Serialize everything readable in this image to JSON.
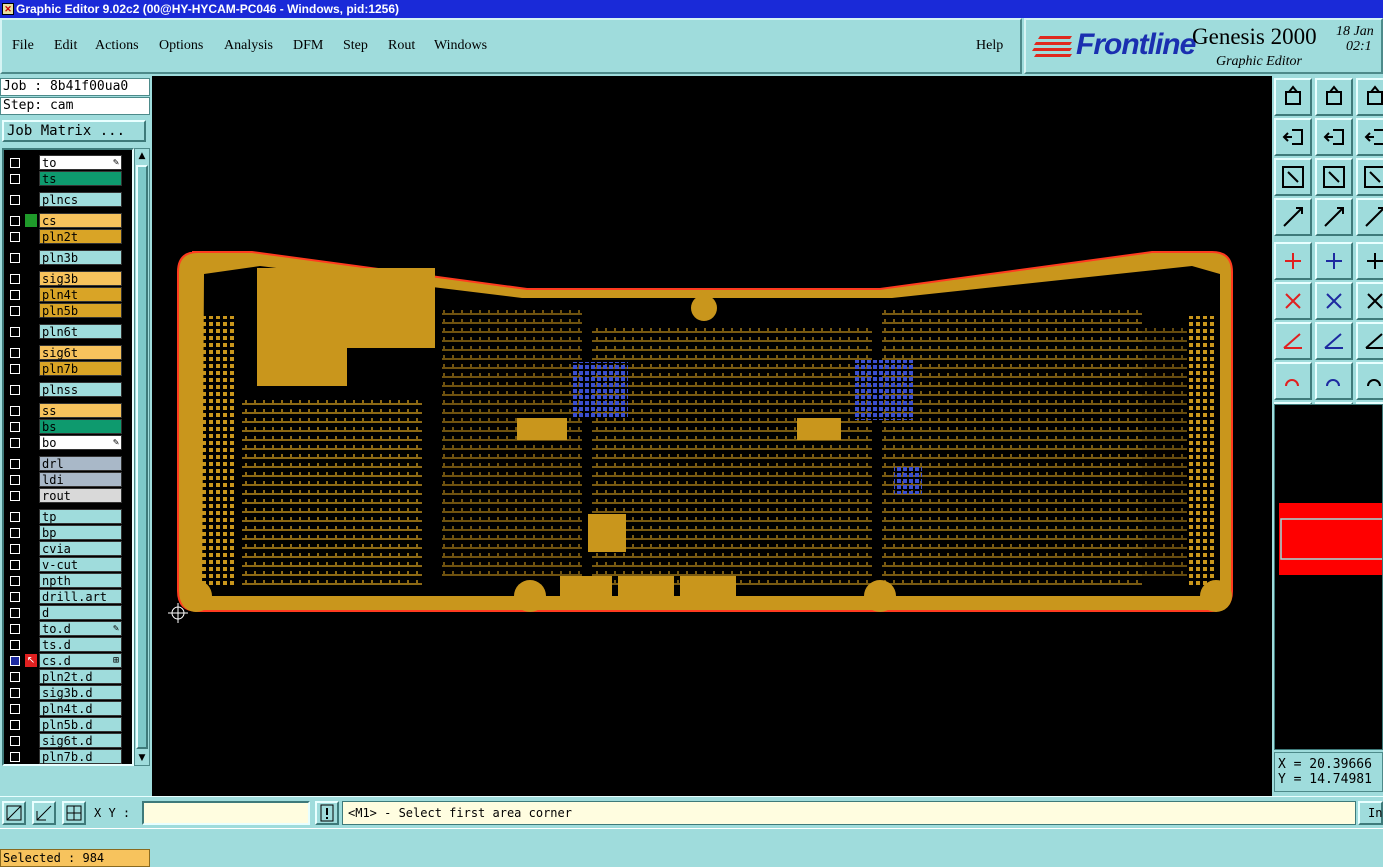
{
  "window": {
    "title": "Graphic Editor 9.02c2 (00@HY-HYCAM-PC046 - Windows, pid:1256)"
  },
  "menu": {
    "items": [
      {
        "label": "File"
      },
      {
        "label": "Edit"
      },
      {
        "label": "Actions"
      },
      {
        "label": "Options"
      },
      {
        "label": "Analysis"
      },
      {
        "label": "DFM"
      },
      {
        "label": "Step"
      },
      {
        "label": "Rout"
      },
      {
        "label": "Windows"
      },
      {
        "label": "Help"
      }
    ]
  },
  "brand": {
    "logo": "Frontline",
    "product": "Genesis 2000",
    "subtitle": "Graphic Editor",
    "date_line1": "18 Jan",
    "date_line2": "02:1"
  },
  "job": {
    "job_label": "Job : 8b41f00ua0",
    "step_label": "Step: cam",
    "matrix_button": "Job Matrix ..."
  },
  "layers": [
    {
      "name": "to",
      "color": "#ffffff",
      "tick": true
    },
    {
      "name": "ts",
      "color": "#0e9a6e"
    },
    {
      "name": "plncs",
      "color": "#9fdcdc"
    },
    {
      "name": "cs",
      "color": "#f7c35d",
      "mark": "#1f9a2a"
    },
    {
      "name": "pln2t",
      "color": "#d9a426"
    },
    {
      "name": "pln3b",
      "color": "#9fdcdc"
    },
    {
      "name": "sig3b",
      "color": "#f7c35d"
    },
    {
      "name": "pln4t",
      "color": "#d9a426"
    },
    {
      "name": "pln5b",
      "color": "#d9a426"
    },
    {
      "name": "pln6t",
      "color": "#9fdcdc"
    },
    {
      "name": "sig6t",
      "color": "#f7c35d"
    },
    {
      "name": "pln7b",
      "color": "#d9a426"
    },
    {
      "name": "plnss",
      "color": "#9fdcdc"
    },
    {
      "name": "ss",
      "color": "#f7c35d"
    },
    {
      "name": "bs",
      "color": "#0e9a6e"
    },
    {
      "name": "bo",
      "color": "#ffffff",
      "tick": true
    },
    {
      "name": "drl",
      "color": "#a9b8c8"
    },
    {
      "name": "ldi",
      "color": "#a9b8c8"
    },
    {
      "name": "rout",
      "color": "#d9d9d9"
    },
    {
      "name": "tp",
      "color": "#9fdcdc"
    },
    {
      "name": "bp",
      "color": "#9fdcdc"
    },
    {
      "name": "cvia",
      "color": "#9fdcdc"
    },
    {
      "name": "v-cut",
      "color": "#9fdcdc"
    },
    {
      "name": "npth",
      "color": "#9fdcdc"
    },
    {
      "name": "drill.art",
      "color": "#9fdcdc"
    },
    {
      "name": "d",
      "color": "#9fdcdc"
    },
    {
      "name": "to.d",
      "color": "#9fdcdc",
      "tick": true
    },
    {
      "name": "ts.d",
      "color": "#9fdcdc"
    },
    {
      "name": "cs.d",
      "color": "#9fdcdc",
      "active": true,
      "plus": true
    },
    {
      "name": "pln2t.d",
      "color": "#9fdcdc"
    },
    {
      "name": "sig3b.d",
      "color": "#9fdcdc"
    },
    {
      "name": "pln4t.d",
      "color": "#9fdcdc"
    },
    {
      "name": "pln5b.d",
      "color": "#9fdcdc"
    },
    {
      "name": "sig6t.d",
      "color": "#9fdcdc"
    },
    {
      "name": "pln7b.d",
      "color": "#9fdcdc"
    }
  ],
  "status": {
    "selected": "Selected : 984",
    "xy_label": "X Y :",
    "xy_value": "",
    "prompt": "<M1> - Select first area corner",
    "right_button": "In"
  },
  "coords": {
    "x": "X = 20.39666",
    "y": "Y = 14.74981"
  },
  "colors": {
    "board": "#c9961c",
    "outline": "#ff3b1f",
    "selection": "#3a4fd0",
    "canvas": "#000000",
    "panel": "#9fdcdc"
  }
}
